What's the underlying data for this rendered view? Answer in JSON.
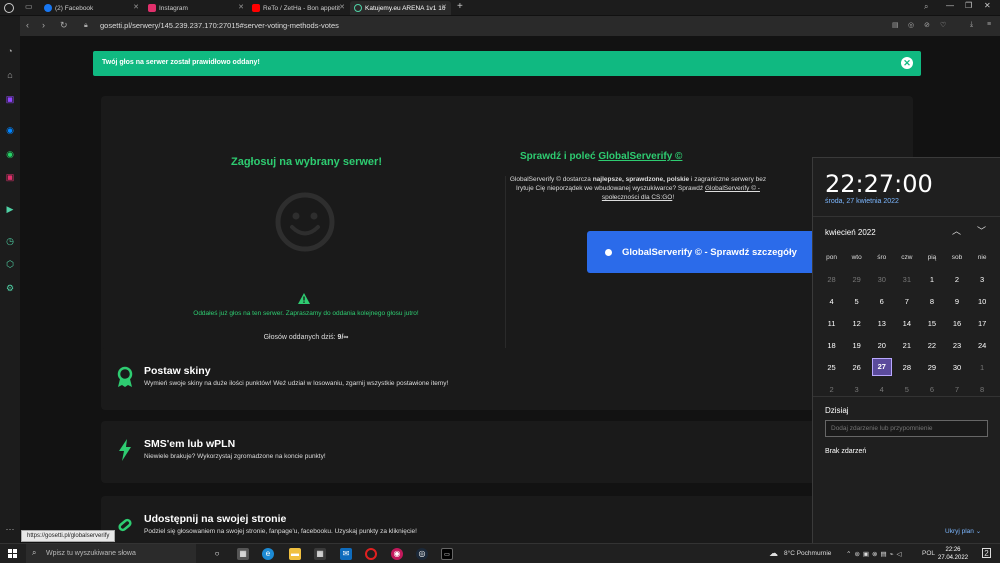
{
  "browser": {
    "tabs": [
      {
        "label": "(2) Facebook",
        "color": "#1877f2"
      },
      {
        "label": "Instagram",
        "color": "#e1306c"
      },
      {
        "label": "ReTo / ZetHa - Bon appetit",
        "color": "#ff0000"
      },
      {
        "label": "Katujemy.eu ARENA 1v1 16",
        "color": "#4fd1a5"
      }
    ],
    "new_tab": "+",
    "url": "gosetti.pl/serwery/145.239.237.170:27015#server-voting-methods-votes",
    "status_url": "https://gosetti.pl/globalserverify"
  },
  "alert": {
    "text": "Twój głos na serwer został prawidłowo oddany!",
    "close": "✕"
  },
  "vote": {
    "title": "Zagłosuj na wybrany serwer!",
    "message": "Oddałeś już głos na ten serwer. Zapraszamy do oddania kolejnego głosu jutro!",
    "count_label": "Głosów oddanych dziś:",
    "count_value": "9/∞"
  },
  "serverify": {
    "title_prefix": "Sprawdź i poleć ",
    "title_link": "GlobalServerify ©",
    "desc_1": "GlobalServerify © dostarcza ",
    "desc_bold": "najlepsze, sprawdzone, polskie",
    "desc_2": " i zagraniczne serwery bez",
    "desc_3": "Irytuje Cię nieporządek we wbudowanej wyszukiwarce? Sprawdź ",
    "desc_link1": "GlobalServerify © -",
    "desc_link2": "społeczności dla CS:GO",
    "desc_end": "!",
    "button": "GlobalServerify © - Sprawdź szczegóły"
  },
  "features": [
    {
      "title": "Postaw skiny",
      "desc": "Wymień swoje skiny na duże ilości punktów! Weź udział w losowaniu, zgarnij wszystkie postawione itemy!"
    },
    {
      "title": "SMS'em lub wPLN",
      "desc": "Niewiele brakuje? Wykorzystaj zgromadzone na koncie punkty!"
    },
    {
      "title": "Udostępnij na swojej stronie",
      "desc": "Podziel się głosowaniem na swojej stronie, fanpage'u, facebooku. Uzyskaj punkty za kliknięcie!"
    }
  ],
  "calendar": {
    "time": "22:27:00",
    "date": "środa, 27 kwietnia 2022",
    "month": "kwiecień 2022",
    "weekdays": [
      "pon",
      "wto",
      "śro",
      "czw",
      "pią",
      "sob",
      "nie"
    ],
    "weeks": [
      [
        "28",
        "29",
        "30",
        "31",
        "1",
        "2",
        "3"
      ],
      [
        "4",
        "5",
        "6",
        "7",
        "8",
        "9",
        "10"
      ],
      [
        "11",
        "12",
        "13",
        "14",
        "15",
        "16",
        "17"
      ],
      [
        "18",
        "19",
        "20",
        "21",
        "22",
        "23",
        "24"
      ],
      [
        "25",
        "26",
        "27",
        "28",
        "29",
        "30",
        "1"
      ],
      [
        "2",
        "3",
        "4",
        "5",
        "6",
        "7",
        "8"
      ]
    ],
    "today_label": "Dzisiaj",
    "event_placeholder": "Dodaj zdarzenie lub przypomnienie",
    "no_events": "Brak zdarzeń",
    "hide_plan": "Ukryj plan ⌄"
  },
  "taskbar": {
    "search_placeholder": "Wpisz tu wyszukiwane słowa",
    "weather": "8°C Pochmurnie",
    "language": "POL",
    "clock_time": "22:26",
    "clock_date": "27.04.2022"
  },
  "colors": {
    "accent_green": "#2ecc71",
    "alert_bg": "#10b981",
    "button_blue": "#2b6bea",
    "today_bg": "#5b4b9c"
  }
}
